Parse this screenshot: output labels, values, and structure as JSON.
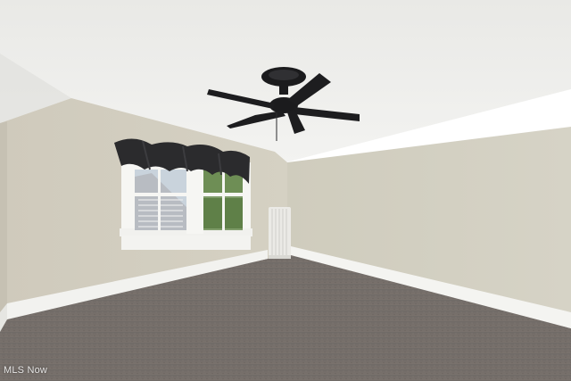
{
  "watermark": {
    "text": "MLS Now"
  },
  "colors": {
    "ceiling": "#efefec",
    "left_wall": "#d3cfbf",
    "right_wall": "#d1cec0",
    "carpet": "#736c68",
    "baseboard": "#f4f4f1",
    "valance": "#2b2b2d",
    "fan": "#1b1b1d",
    "window_frame": "#f6f6f3",
    "radiator": "#ebeae6"
  },
  "icons": [
    "ceiling-fan",
    "window",
    "radiator",
    "valance"
  ]
}
